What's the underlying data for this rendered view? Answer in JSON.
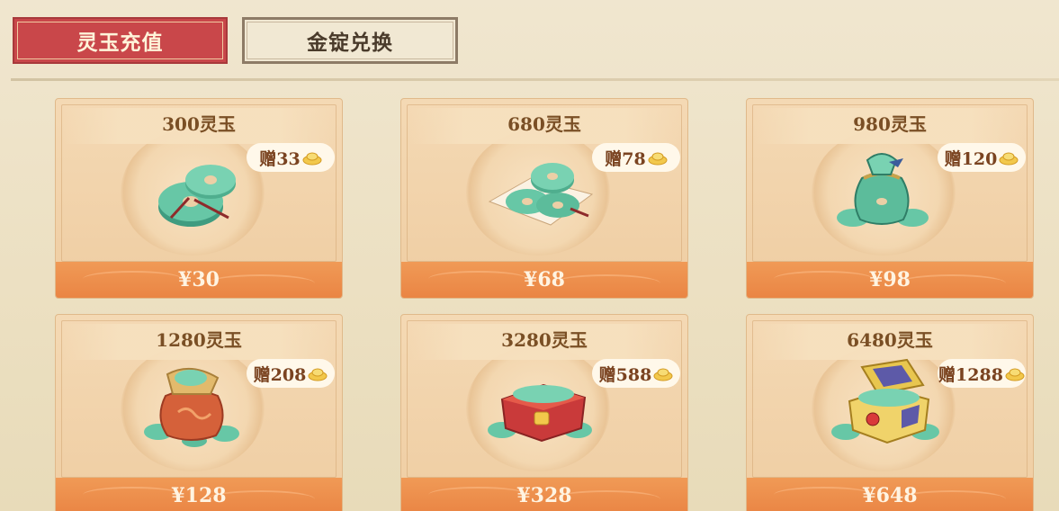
{
  "tabs": [
    {
      "label": "灵玉充值",
      "active": true
    },
    {
      "label": "金锭兑换",
      "active": false
    }
  ],
  "products": [
    {
      "title": "300灵玉",
      "bonus": "赠33",
      "price": "¥30",
      "art": "jade-coins-icon"
    },
    {
      "title": "680灵玉",
      "bonus": "赠78",
      "price": "¥68",
      "art": "jade-coins-on-cloth-icon"
    },
    {
      "title": "980灵玉",
      "bonus": "赠120",
      "price": "¥98",
      "art": "jade-coin-pouch-icon"
    },
    {
      "title": "1280灵玉",
      "bonus": "赠208",
      "price": "¥128",
      "art": "jade-coin-sack-icon"
    },
    {
      "title": "3280灵玉",
      "bonus": "赠588",
      "price": "¥328",
      "art": "jade-coin-red-chest-icon"
    },
    {
      "title": "6480灵玉",
      "bonus": "赠1288",
      "price": "¥648",
      "art": "jade-coin-gold-chest-icon"
    }
  ],
  "colors": {
    "active_tab": "#c9474a",
    "price_bar": "#ea8544",
    "jade": "#5fbf9f",
    "gold_ingot": "#f2c84b"
  }
}
